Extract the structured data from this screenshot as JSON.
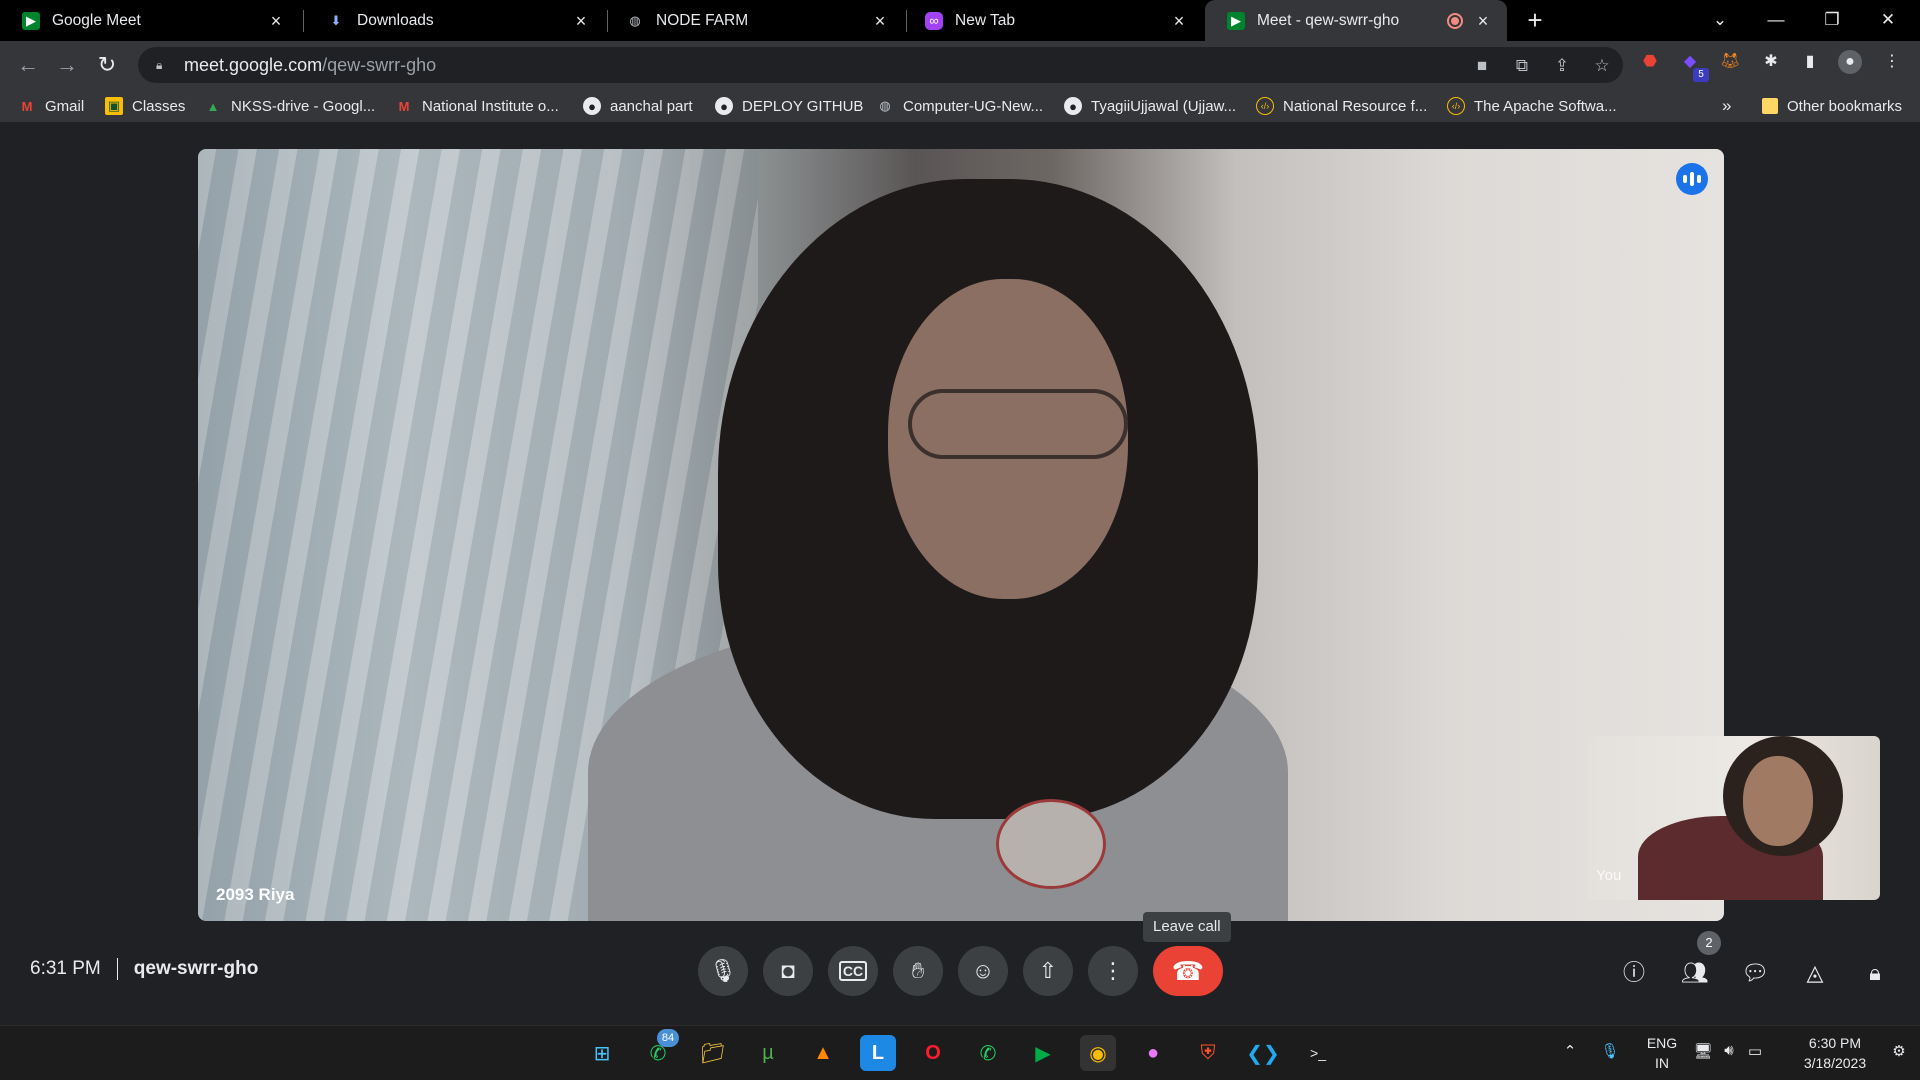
{
  "browser": {
    "tabs": [
      {
        "title": "Google Meet",
        "favicon": "meet-icon",
        "active": false
      },
      {
        "title": "Downloads",
        "favicon": "download-icon",
        "active": false
      },
      {
        "title": "NODE FARM",
        "favicon": "globe-icon",
        "active": false
      },
      {
        "title": "New Tab",
        "favicon": "new-tab-icon",
        "active": false
      },
      {
        "title": "Meet - qew-swrr-gho",
        "favicon": "meet-icon",
        "active": true
      }
    ],
    "address_host": "meet.google.com",
    "address_path": "/qew-swrr-gho",
    "extension_badge": "5"
  },
  "bookmarks": [
    {
      "label": "Gmail",
      "icon": "gmail-icon"
    },
    {
      "label": "Classes",
      "icon": "classroom-icon"
    },
    {
      "label": "NKSS-drive - Googl...",
      "icon": "drive-icon"
    },
    {
      "label": "National Institute o...",
      "icon": "gmail-icon"
    },
    {
      "label": "aanchal part",
      "icon": "github-icon"
    },
    {
      "label": "DEPLOY GITHUB",
      "icon": "github-icon"
    },
    {
      "label": "Computer-UG-New...",
      "icon": "globe-icon"
    },
    {
      "label": "TyagiiUjjawal (Ujjaw...",
      "icon": "github-icon"
    },
    {
      "label": "National Resource f...",
      "icon": "code-icon"
    },
    {
      "label": "The Apache Softwa...",
      "icon": "code-icon"
    }
  ],
  "bookmarks_overflow": "»",
  "other_bookmarks": "Other bookmarks",
  "meet": {
    "main_participant": "2093 Riya",
    "self_label": "You",
    "clock": "6:31 PM",
    "meeting_code": "qew-swrr-gho",
    "tooltip": "Leave call",
    "people_count": "2"
  },
  "taskbar": {
    "whatsapp_badge": "84",
    "lang_top": "ENG",
    "lang_bottom": "IN",
    "time": "6:30 PM",
    "date": "3/18/2023"
  },
  "colors": {
    "end_call": "#ea4335",
    "speaking_indicator": "#1a73e8",
    "control_bg": "#3c4043"
  }
}
